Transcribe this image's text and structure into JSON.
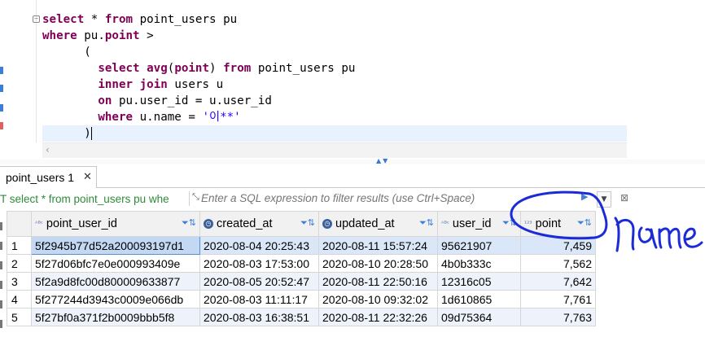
{
  "editor": {
    "lines": [
      [
        {
          "t": "select",
          "c": "kw"
        },
        {
          "t": " * "
        },
        {
          "t": "from",
          "c": "kw"
        },
        {
          "t": " point_users pu"
        }
      ],
      [
        {
          "t": "where",
          "c": "kw"
        },
        {
          "t": " pu."
        },
        {
          "t": "point",
          "c": "kw"
        },
        {
          "t": " >"
        }
      ],
      [
        {
          "t": "      ("
        }
      ],
      [
        {
          "t": "        "
        },
        {
          "t": "select",
          "c": "kw"
        },
        {
          "t": " "
        },
        {
          "t": "avg",
          "c": "kw"
        },
        {
          "t": "("
        },
        {
          "t": "point",
          "c": "kw"
        },
        {
          "t": ") "
        },
        {
          "t": "from",
          "c": "kw"
        },
        {
          "t": " point_users pu"
        }
      ],
      [
        {
          "t": "        "
        },
        {
          "t": "inner",
          "c": "kw"
        },
        {
          "t": " "
        },
        {
          "t": "join",
          "c": "kw"
        },
        {
          "t": " users u"
        }
      ],
      [
        {
          "t": "        "
        },
        {
          "t": "on",
          "c": "kw"
        },
        {
          "t": " pu.user_id = u.user_id"
        }
      ],
      [
        {
          "t": "        "
        },
        {
          "t": "where",
          "c": "kw"
        },
        {
          "t": " u.name = "
        },
        {
          "t": "'이**'",
          "c": "str"
        }
      ],
      [
        {
          "t": "      )"
        }
      ]
    ],
    "scroll_left_icon": "chevron-left-icon"
  },
  "result_tab": {
    "label": "point_users 1",
    "close_icon": "close-icon"
  },
  "filter": {
    "query_text": "T select * from point_users pu whe",
    "placeholder": "Enter a SQL expression to filter results (use Ctrl+Space)",
    "filter_icon": "expand-icon",
    "play_icon": "play-icon",
    "dropdown_icon": "chevron-down-icon"
  },
  "grid": {
    "columns": [
      {
        "label": "point_user_id",
        "type_icon": "abc-type-icon"
      },
      {
        "label": "created_at",
        "type_icon": "clock-icon"
      },
      {
        "label": "updated_at",
        "type_icon": "clock-icon"
      },
      {
        "label": "user_id",
        "type_icon": "abc-key-type-icon"
      },
      {
        "label": "point",
        "type_icon": "number-type-icon"
      }
    ],
    "rows": [
      [
        "1",
        "5f2945b77d52a200093197d1",
        "2020-08-04 20:25:43",
        "2020-08-11 15:57:24",
        "95621907",
        "7,459"
      ],
      [
        "2",
        "5f27d06bfc7e0e000993409e",
        "2020-08-03 17:53:00",
        "2020-08-10 20:28:50",
        "4b0b333c",
        "7,562"
      ],
      [
        "3",
        "5f2a9d8fc00d800009633877",
        "2020-08-05 20:52:47",
        "2020-08-11 22:50:16",
        "12316c05",
        "7,642"
      ],
      [
        "4",
        "5f277244d3943c0009e066db",
        "2020-08-03 11:11:17",
        "2020-08-10 09:32:02",
        "1d610865",
        "7,761"
      ],
      [
        "5",
        "5f27bf0a371f2b0009bbb5f8",
        "2020-08-03 16:38:51",
        "2020-08-11 22:32:26",
        "09d75364",
        "7,763"
      ]
    ]
  },
  "annotation": {
    "handwritten_text": "name",
    "ink_color": "#1c2bd8"
  },
  "colors": {
    "keyword": "#7f0055",
    "string": "#2a00ff",
    "selection": "#c2d8f3",
    "current_line": "#e8f2fe",
    "filter_query": "#2e8b3a"
  }
}
